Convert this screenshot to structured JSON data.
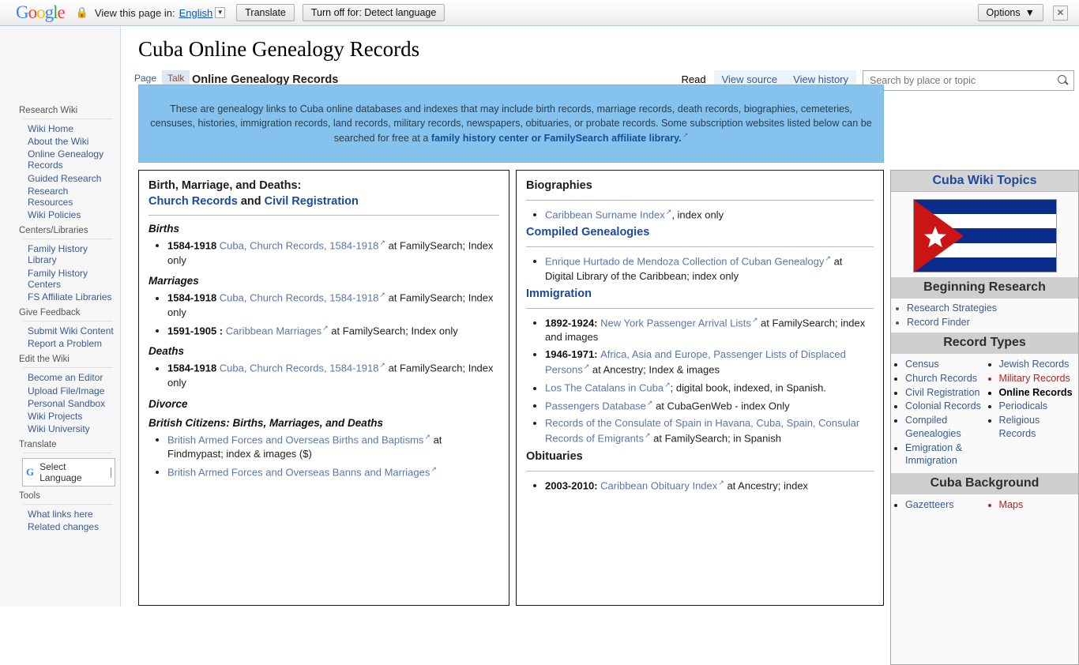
{
  "translate_bar": {
    "logo": "Google",
    "lock_icon": "lock-icon",
    "view_label": "View this page in:",
    "language": "English",
    "translate_button": "Translate",
    "turnoff_button": "Turn off for: Detect language",
    "options_button": "Options",
    "close_icon": "✕"
  },
  "left_sidebar": {
    "sections": [
      {
        "heading": "Research Wiki",
        "items": [
          "Wiki Home",
          "About the Wiki",
          "Online Genealogy Records",
          "Guided Research",
          "Research Resources",
          "Wiki Policies"
        ]
      },
      {
        "heading": "Centers/Libraries",
        "items": [
          "Family History Library",
          "Family History Centers",
          "FS Affiliate Libraries"
        ]
      },
      {
        "heading": "Give Feedback",
        "items": [
          "Submit Wiki Content",
          "Report a Problem"
        ]
      },
      {
        "heading": "Edit the Wiki",
        "items": [
          "Become an Editor",
          "Upload File/Image",
          "Personal Sandbox",
          "Wiki Projects",
          "Wiki University"
        ]
      },
      {
        "heading": "Translate",
        "select_language": "Select Language"
      },
      {
        "heading": "Tools",
        "items": [
          "What links here",
          "Related changes"
        ]
      }
    ]
  },
  "header": {
    "page_title": "Cuba Online Genealogy Records",
    "subtitle": "Online Genealogy Records",
    "tabs_left": [
      {
        "label": "Page",
        "selected": false
      },
      {
        "label": "Talk",
        "selected": true
      }
    ],
    "tabs_right": [
      {
        "label": "Read",
        "selected": true
      },
      {
        "label": "View source",
        "selected": false
      },
      {
        "label": "View history",
        "selected": false
      }
    ],
    "search_placeholder": "Search by place or topic",
    "search_value": "",
    "search_icon": "search-icon"
  },
  "notice": {
    "text_1": "These are genealogy links to Cuba online databases and indexes that may include birth records, marriage records, death records, biographies, cemeteries, censuses, histories, immigration records, land records, military records, newspapers, obituaries, or probate records. Some subscription websites listed below can be searched for free at a ",
    "link": "family history center or FamilySearch affiliate library.",
    "background": "#85c2ee"
  },
  "left_column": {
    "heading_line1": "Birth, Marriage, and Deaths:",
    "heading_link1": "Church Records",
    "heading_and": " and ",
    "heading_link2": "Civil Registration",
    "sections": [
      {
        "title": "Births",
        "items": [
          {
            "prefix": "1584-1918",
            "link": "Cuba, Church Records, 1584-1918",
            "suffix": " at FamilySearch; Index only"
          }
        ]
      },
      {
        "title": "Marriages",
        "items": [
          {
            "prefix": "1584-1918",
            "link": "Cuba, Church Records, 1584-1918",
            "suffix": " at FamilySearch; Index only"
          },
          {
            "prefix": "1591-1905 :",
            "link": "Caribbean Marriages",
            "suffix": " at FamilySearch; Index only"
          }
        ]
      },
      {
        "title": "Deaths",
        "items": [
          {
            "prefix": "1584-1918",
            "link": "Cuba, Church Records, 1584-1918",
            "suffix": " at FamilySearch; Index only"
          }
        ]
      },
      {
        "title": "Divorce",
        "items": []
      }
    ],
    "british_heading": "British Citizens: Births, Marriages, and Deaths",
    "british_items": [
      {
        "prefix": "",
        "link": "British Armed Forces and Overseas Births and Baptisms",
        "suffix": " at Findmypast; index & images ($)"
      },
      {
        "prefix": "",
        "link": "British Armed Forces and Overseas Banns and Marriages",
        "suffix": ""
      }
    ]
  },
  "right_column": {
    "sections": [
      {
        "title": "Biographies",
        "title_color": "dark",
        "items": [
          {
            "prefix": "",
            "link": "Caribbean Surname Index",
            "suffix": ", index only"
          }
        ]
      },
      {
        "title": "Compiled Genealogies",
        "title_color": "blue",
        "items": [
          {
            "prefix": "",
            "link": "Enrique Hurtado de Mendoza Collection of Cuban Genealogy",
            "suffix": " at Digital Library of the Caribbean; index only"
          }
        ]
      },
      {
        "title": "Immigration",
        "title_color": "blue",
        "items": [
          {
            "prefix": "1892-1924:",
            "link": "New York Passenger Arrival Lists",
            "suffix": " at FamilySearch; index and images"
          },
          {
            "prefix": "1946-1971:",
            "link": "Africa, Asia and Europe, Passenger Lists of Displaced Persons",
            "suffix": " at Ancestry; Index & images"
          },
          {
            "prefix": "",
            "link": "Los The Catalans in Cuba",
            "suffix": "; digital book, indexed, in Spanish."
          },
          {
            "prefix": "",
            "link": "Passengers Database",
            "suffix": " at CubaGenWeb - index Only"
          },
          {
            "prefix": "",
            "link": "Records of the Consulate of Spain in Havana, Cuba, Spain, Consular Records of Emigrants",
            "suffix": " at FamilySearch; in Spanish"
          }
        ]
      },
      {
        "title": "Obituaries",
        "title_color": "dark",
        "items": [
          {
            "prefix": "2003-2010:",
            "link": "Caribbean Obituary Index",
            "suffix": " at Ancestry; index"
          }
        ]
      }
    ]
  },
  "info_panel": {
    "title": "Cuba Wiki Topics",
    "flag_alt": "cuba-flag",
    "flag_colors": {
      "blue": "#0A2D8C",
      "white": "#FFFFFF",
      "red": "#CB1515"
    },
    "sections": [
      {
        "heading": "Beginning Research",
        "layout": "single",
        "items": [
          {
            "label": "Research Strategies",
            "style": "link"
          },
          {
            "label": "Record Finder",
            "style": "link"
          }
        ]
      },
      {
        "heading": "Record Types",
        "layout": "double",
        "col1": [
          {
            "label": "Census",
            "style": "link"
          },
          {
            "label": "Church Records",
            "style": "link"
          },
          {
            "label": "Civil Registration",
            "style": "link"
          },
          {
            "label": "Colonial Records",
            "style": "link"
          },
          {
            "label": "Compiled Genealogies",
            "style": "link"
          },
          {
            "label": "Emigration & Immigration",
            "style": "link"
          }
        ],
        "col2": [
          {
            "label": "Jewish Records",
            "style": "link"
          },
          {
            "label": "Military Records",
            "style": "red"
          },
          {
            "label": "Online Records",
            "style": "current"
          },
          {
            "label": "Periodicals",
            "style": "link"
          },
          {
            "label": "Religious Records",
            "style": "link"
          }
        ]
      },
      {
        "heading": "Cuba Background",
        "layout": "double",
        "col1": [
          {
            "label": "Gazetteers",
            "style": "link"
          }
        ],
        "col2": [
          {
            "label": "Maps",
            "style": "red"
          }
        ]
      }
    ]
  }
}
